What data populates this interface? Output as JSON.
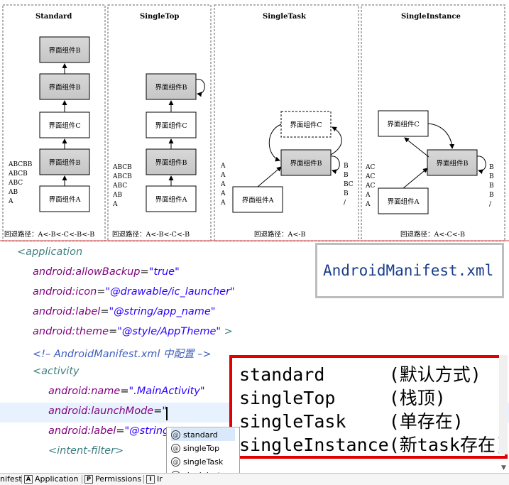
{
  "diagram": {
    "box_label_b": "界面组件B",
    "box_label_c": "界面组件C",
    "box_label_a": "界面组件A",
    "panels": [
      {
        "title": "Standard",
        "stack": [
          "ABCBB",
          "ABCB",
          "ABC",
          "AB",
          "A"
        ],
        "stack_right": [],
        "return_path": "回退路径：A<-B<-C<-B<-B"
      },
      {
        "title": "SingleTop",
        "stack": [
          "ABCB",
          "ABCB",
          "ABC",
          "AB",
          "A"
        ],
        "stack_right": [],
        "return_path": "回退路径：A<-B<-C<-B"
      },
      {
        "title": "SingleTask",
        "stack": [
          "A",
          "A",
          "A",
          "A",
          "A"
        ],
        "stack_right": [
          "B",
          "B",
          "BC",
          "B",
          "/"
        ],
        "return_path": "回退路径：A<-B"
      },
      {
        "title": "SingleInstance",
        "stack": [
          "AC",
          "AC",
          "AC",
          "A",
          "A"
        ],
        "stack_right": [
          "B",
          "B",
          "B",
          "B",
          "/"
        ],
        "return_path": "回退路径：A<-C<-B"
      }
    ]
  },
  "editor": {
    "line1_tag": "<application",
    "line2_attr": "android:allowBackup",
    "line2_val": "\"true\"",
    "line3_attr": "android:icon",
    "line3_val": "\"@drawable/ic_launcher\"",
    "line4_attr": "android:label",
    "line4_val": "\"@string/app_name\"",
    "line5_attr": "android:theme",
    "line5_val": "\"@style/AppTheme\"",
    "line5_end": " >",
    "line6_comment": "<!– AndroidManifest.xml 中配置 –>",
    "line7_tag": "<activity",
    "line8_attr": "android:name",
    "line8_val": "\".MainActivity\"",
    "line9_attr": "android:launchMode",
    "line9_val": "\"",
    "line10_attr": "android:label",
    "line10_val": "\"@string",
    "line11_tag": "<intent-filter>",
    "equals": "="
  },
  "manifest_callout": "AndroidManifest.xml",
  "launch_modes": [
    "standard      (默认方式)",
    "singleTop     (栈顶)",
    "singleTask    (单存在)",
    "singleInstance(新task存在)"
  ],
  "autocomplete": {
    "icon": "@",
    "items": [
      "standard",
      "singleTop",
      "singleTask",
      "singleInstance"
    ]
  },
  "tabs": [
    {
      "icon": "",
      "label": "nifest"
    },
    {
      "icon": "A",
      "label": "Application"
    },
    {
      "icon": "P",
      "label": "Permissions"
    },
    {
      "icon": "I",
      "label": "Ir"
    }
  ]
}
